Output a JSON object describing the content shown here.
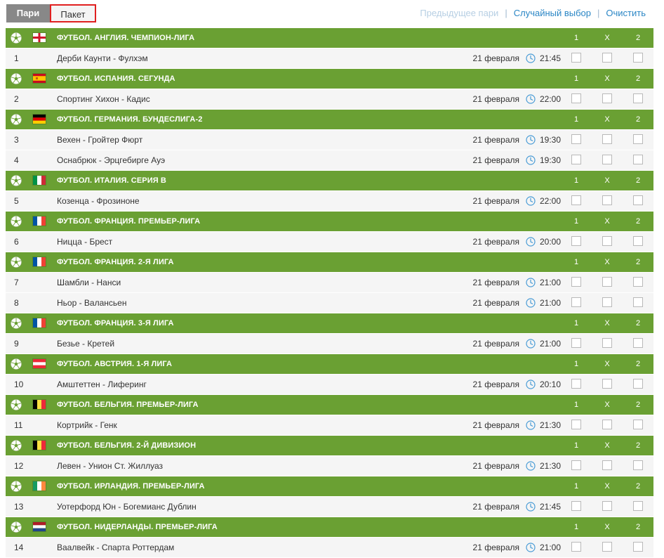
{
  "tabs": {
    "pari": "Пари",
    "paket": "Пакет"
  },
  "links": {
    "prev": "Предыдущее пари",
    "random": "Случайный выбор",
    "clear": "Очистить"
  },
  "odds_headers": {
    "one": "1",
    "draw": "X",
    "two": "2"
  },
  "icons": {
    "sport": "soccer-ball-icon",
    "time": "clock-icon"
  },
  "colors": {
    "league_bar": "#6aa033",
    "row_bg": "#f5f5f5",
    "link": "#2a86c5",
    "tab_active": "#888888",
    "highlight": "#e02020"
  },
  "leagues": [
    {
      "name": "ФУТБОЛ. АНГЛИЯ. ЧЕМПИОН-ЛИГА",
      "flag": "england",
      "matches": [
        {
          "num": "1",
          "teams": "Дерби Каунти - Фулхэм",
          "date": "21 февраля",
          "time": "21:45"
        }
      ]
    },
    {
      "name": "ФУТБОЛ. ИСПАНИЯ. СЕГУНДА",
      "flag": "spain",
      "matches": [
        {
          "num": "2",
          "teams": "Спортинг Хихон - Кадис",
          "date": "21 февраля",
          "time": "22:00"
        }
      ]
    },
    {
      "name": "ФУТБОЛ. ГЕРМАНИЯ. БУНДЕСЛИГА-2",
      "flag": "germany",
      "matches": [
        {
          "num": "3",
          "teams": "Вехен - Гройтер Фюрт",
          "date": "21 февраля",
          "time": "19:30"
        },
        {
          "num": "4",
          "teams": "Оснабрюк - Эрцгебирге Ауэ",
          "date": "21 февраля",
          "time": "19:30"
        }
      ]
    },
    {
      "name": "ФУТБОЛ. ИТАЛИЯ. СЕРИЯ B",
      "flag": "italy",
      "matches": [
        {
          "num": "5",
          "teams": "Козенца - Фрозиноне",
          "date": "21 февраля",
          "time": "22:00"
        }
      ]
    },
    {
      "name": "ФУТБОЛ. ФРАНЦИЯ. ПРЕМЬЕР-ЛИГА",
      "flag": "france",
      "matches": [
        {
          "num": "6",
          "teams": "Ницца - Брест",
          "date": "21 февраля",
          "time": "20:00"
        }
      ]
    },
    {
      "name": "ФУТБОЛ. ФРАНЦИЯ. 2-Я ЛИГА",
      "flag": "france",
      "matches": [
        {
          "num": "7",
          "teams": "Шамбли - Нанси",
          "date": "21 февраля",
          "time": "21:00"
        },
        {
          "num": "8",
          "teams": "Ньор - Валансьен",
          "date": "21 февраля",
          "time": "21:00"
        }
      ]
    },
    {
      "name": "ФУТБОЛ. ФРАНЦИЯ. 3-Я ЛИГА",
      "flag": "france",
      "matches": [
        {
          "num": "9",
          "teams": "Безье - Кретей",
          "date": "21 февраля",
          "time": "21:00"
        }
      ]
    },
    {
      "name": "ФУТБОЛ. АВСТРИЯ. 1-Я ЛИГА",
      "flag": "austria",
      "matches": [
        {
          "num": "10",
          "teams": "Амштеттен - Лиферинг",
          "date": "21 февраля",
          "time": "20:10"
        }
      ]
    },
    {
      "name": "ФУТБОЛ. БЕЛЬГИЯ. ПРЕМЬЕР-ЛИГА",
      "flag": "belgium",
      "matches": [
        {
          "num": "11",
          "teams": "Кортрийк - Генк",
          "date": "21 февраля",
          "time": "21:30"
        }
      ]
    },
    {
      "name": "ФУТБОЛ. БЕЛЬГИЯ. 2-Й ДИВИЗИОН",
      "flag": "belgium",
      "matches": [
        {
          "num": "12",
          "teams": "Левен - Унион Ст. Жиллуаз",
          "date": "21 февраля",
          "time": "21:30"
        }
      ]
    },
    {
      "name": "ФУТБОЛ. ИРЛАНДИЯ. ПРЕМЬЕР-ЛИГА",
      "flag": "ireland",
      "matches": [
        {
          "num": "13",
          "teams": "Уотерфорд Юн - Богемианс Дублин",
          "date": "21 февраля",
          "time": "21:45"
        }
      ]
    },
    {
      "name": "ФУТБОЛ. НИДЕРЛАНДЫ. ПРЕМЬЕР-ЛИГА",
      "flag": "netherlands",
      "matches": [
        {
          "num": "14",
          "teams": "Ваалвейк - Спарта Роттердам",
          "date": "21 февраля",
          "time": "21:00"
        }
      ]
    }
  ]
}
